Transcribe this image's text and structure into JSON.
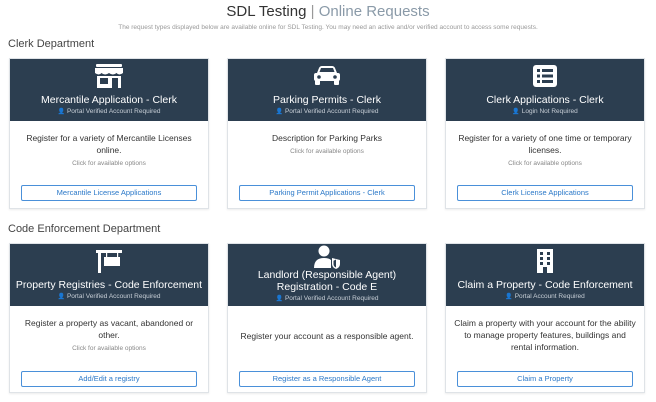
{
  "header": {
    "title_main": "SDL Testing",
    "title_sep": "|",
    "title_sub": "Online Requests",
    "note": "The request types displayed below are available online for SDL Testing. You may need an active and/or verified account to access some requests."
  },
  "departments": [
    {
      "name": "Clerk Department",
      "cards": [
        {
          "icon": "storefront-icon",
          "title": "Mercantile Application - Clerk",
          "requirement": "Portal Verified Account Required",
          "description": "Register for a variety of Mercantile Licenses online.",
          "hint": "Click for available options",
          "button": "Mercantile License Applications"
        },
        {
          "icon": "car-icon",
          "title": "Parking Permits - Clerk",
          "requirement": "Portal Verified Account Required",
          "description": "Description for Parking Parks",
          "hint": "Click for available options",
          "button": "Parking Permit Applications - Clerk"
        },
        {
          "icon": "list-icon",
          "title": "Clerk Applications - Clerk",
          "requirement": "Login Not Required",
          "description": "Register for a variety of one time or temporary licenses.",
          "hint": "Click for available options",
          "button": "Clerk License Applications"
        }
      ]
    },
    {
      "name": "Code Enforcement Department",
      "cards": [
        {
          "icon": "sign-post-icon",
          "title": "Property Registries - Code Enforcement",
          "requirement": "Portal Verified Account Required",
          "description": "Register a property as vacant, abandoned or other.",
          "hint": "Click for available options",
          "button": "Add/Edit a registry"
        },
        {
          "icon": "user-shield-icon",
          "title": "Landlord (Responsible Agent) Registration - Code E",
          "requirement": "Portal Verified Account Required",
          "description": "Register your account as a responsible agent.",
          "button": "Register as a Responsible Agent"
        },
        {
          "icon": "building-icon",
          "title": "Claim a Property - Code Enforcement",
          "requirement": "Portal Account Required",
          "description": "Claim a property with your account for the ability to manage property features, buildings and rental information.",
          "button": "Claim a Property"
        }
      ]
    }
  ]
}
